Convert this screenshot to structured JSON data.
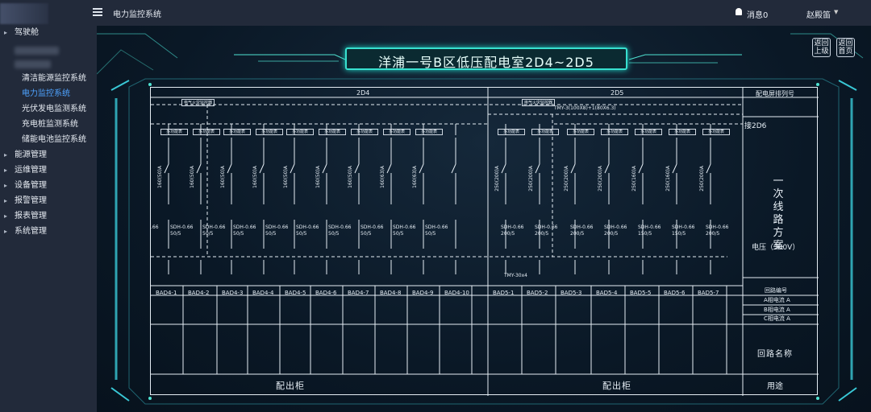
{
  "sidebar": {
    "items": [
      {
        "label": "驾驶舱",
        "type": "group"
      },
      {
        "label": "清洁能源监控系统",
        "type": "sub"
      },
      {
        "label": "电力监控系统",
        "type": "sub",
        "active": true
      },
      {
        "label": "光伏发电监测系统",
        "type": "sub"
      },
      {
        "label": "充电桩监测系统",
        "type": "sub"
      },
      {
        "label": "储能电池监控系统",
        "type": "sub"
      },
      {
        "label": "能源管理",
        "type": "group"
      },
      {
        "label": "运维管理",
        "type": "group"
      },
      {
        "label": "设备管理",
        "type": "group"
      },
      {
        "label": "报警管理",
        "type": "group"
      },
      {
        "label": "报表管理",
        "type": "group"
      },
      {
        "label": "系统管理",
        "type": "group"
      }
    ]
  },
  "topbar": {
    "title": "电力监控系统",
    "messages": "消息0",
    "user": "赵殿笛"
  },
  "main": {
    "title": "洋浦一号B区低压配电室2D4~2D5",
    "btn_up": {
      "l1": "返回",
      "l2": "上级"
    },
    "btn_home": {
      "l1": "返回",
      "l2": "首页"
    }
  },
  "diagram": {
    "header_2d4": "2D4",
    "header_2d5": "2D5",
    "header_seq": "配电屏排列号",
    "label_2d6": "接2D6",
    "vertical_title": "一次线路方案",
    "voltage": "电压（380V）",
    "loop_no": "回路编号",
    "phase_a": "A相电流 A",
    "phase_b": "B相电流 A",
    "phase_c": "C相电流 A",
    "loop_name": "回路名称",
    "usage": "用途",
    "out_label_left": "配出柜",
    "out_label_right": "配出柜",
    "fire_monitor": "电气火灾监控器",
    "meter": "多功能表",
    "busbar": "TMY-3(100X8)+1(80X6.3)",
    "tmy30": "TMY-30x4",
    "ct_model": "SDH-0.66",
    "frag": ".66",
    "ratings_2d4": [
      "160(50)A",
      "160(50)A",
      "160(50)A",
      "160(50)A",
      "160(50)A",
      "160(50)A",
      "160(50)A",
      "160(63)A",
      "160(63)A"
    ],
    "ratings_2d5": [
      "250(200)A",
      "250(200)A",
      "250(200)A",
      "250(200)A",
      "250(160)A",
      "250(160)A",
      "250(200)A"
    ],
    "ct_ratio_2d4": [
      "50/5",
      "50/5",
      "50/5",
      "50/5",
      "50/5",
      "50/5",
      "50/5",
      "50/5",
      "50/5"
    ],
    "ct_ratio_2d5": [
      "200/5",
      "200/5",
      "200/5",
      "200/5",
      "150/5",
      "150/5",
      "200/5"
    ],
    "circuits_2d4": [
      "BAD4-1",
      "BAD4-2",
      "BAD4-3",
      "BAD4-4",
      "BAD4-5",
      "BAD4-6",
      "BAD4-7",
      "BAD4-8",
      "BAD4-9",
      "BAD4-10"
    ],
    "circuits_2d5": [
      "BAD5-1",
      "BAD5-2",
      "BAD5-3",
      "BAD5-4",
      "BAD5-5",
      "BAD5-6",
      "BAD5-7"
    ]
  }
}
